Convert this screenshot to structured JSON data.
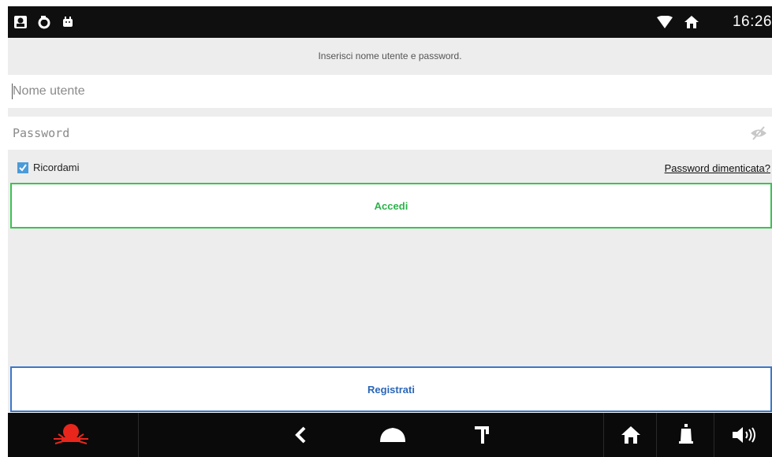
{
  "status_bar": {
    "time": "16:26",
    "icons": [
      "app-badge-icon",
      "sync-icon",
      "android-icon",
      "wifi-icon",
      "home-status-icon"
    ]
  },
  "login": {
    "hint": "Inserisci nome utente e password.",
    "username_placeholder": "Nome utente",
    "password_placeholder": "Password",
    "remember_label": "Ricordami",
    "remember_checked": true,
    "forgot_label": "Password dimenticata?",
    "login_label": "Accedi",
    "register_label": "Registrati"
  },
  "colors": {
    "login_accent": "#3dc253",
    "register_accent": "#3b78c8",
    "alarm_icon": "#e8261c"
  },
  "nav_bar": {
    "icons": [
      "alarm-icon",
      "back-icon",
      "home-icon",
      "recents-icon",
      "house-icon",
      "bell-icon",
      "volume-icon"
    ]
  }
}
